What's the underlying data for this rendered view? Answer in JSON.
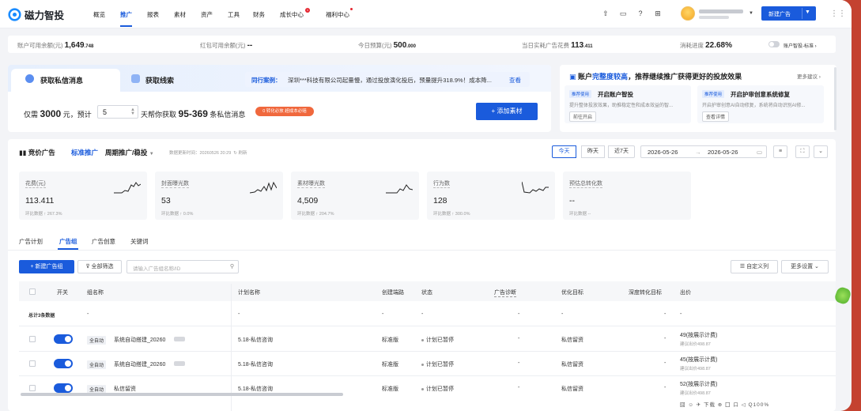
{
  "app": {
    "name": "磁力智投"
  },
  "nav": {
    "items": [
      "概览",
      "推广",
      "报表",
      "素材",
      "资产",
      "工具",
      "财务",
      "成长中心",
      "福利中心"
    ],
    "active": "推广",
    "growth_badge": "1",
    "new_ad_label": "新建广告"
  },
  "account": {
    "available_label": "账户可用余额(元)",
    "available_value": "1,649",
    "available_decimal": ".748",
    "redpacket_label": "红包可用余额(元)",
    "redpacket_value": "--",
    "budget_label": "今日预算(元)",
    "budget_value": "500",
    "budget_decimal": ".000",
    "spend_label": "当日实耗广告花费",
    "spend_value": "113",
    "spend_decimal": ".411",
    "progress_label": "消耗进度",
    "progress_value": "22.68%",
    "smart_label": "账户智投-标准"
  },
  "promo": {
    "tab1": "获取私信消息",
    "tab2": "获取线索",
    "case_tag": "同行案例：",
    "case_text": "深圳***科技有限公司起量慢，通过投放演化投后，预量提升318.9%！成本降...",
    "case_link": "查看",
    "budget_prefix": "仅需",
    "budget_amount": "3000",
    "budget_mid": "元，预计",
    "days": "5",
    "budget_get": "天帮你获取",
    "range": "95-369",
    "range_suffix": "条私信消息",
    "orange_badge": "0 转化必放 超成本必赔",
    "add_material": "+ 添加素材"
  },
  "health": {
    "title_prefix": "账户",
    "title_highlight": "完整度较高",
    "title_suffix": "，推荐继续推广获得更好的投放效果",
    "more": "更多建议 ›",
    "cards": [
      {
        "badge": "推荐使用",
        "title": "开启账户智投",
        "desc": "提升整体投放效果，助推稳定性和成本效益的智...",
        "button": "前往开启"
      },
      {
        "badge": "推荐使用",
        "title": "开启护审创意系统修复",
        "desc": "开启护审创意AI自动修复，系统将自动识别AI修...",
        "button": "查看详情"
      }
    ]
  },
  "campaign": {
    "section": "竞价广告",
    "standard": "标准推广",
    "periodic": "周期推广/稳投",
    "update_time": "数据更新时间：20260526 20:29",
    "refresh": "刷新",
    "date_buttons": [
      "今天",
      "昨天",
      "近7天"
    ],
    "start_date": "2026-05-26",
    "end_date": "2026-05-26"
  },
  "metrics": [
    {
      "label": "花费(元)",
      "value": "113.411",
      "change": "环比数据 ↑ 267.3%"
    },
    {
      "label": "封面曝光数",
      "value": "53",
      "change": "环比数据 ↑ 0.0%"
    },
    {
      "label": "素材曝光数",
      "value": "4,509",
      "change": "环比数据 ↑ 204.7%"
    },
    {
      "label": "行为数",
      "value": "128",
      "change": "环比数据 ↑ 300.0%"
    },
    {
      "label": "预估总转化数",
      "value": "--",
      "change": "环比数据 --"
    }
  ],
  "subtabs": [
    "广告计划",
    "广告组",
    "广告创意",
    "关键词"
  ],
  "toolbar": {
    "new_group": "+ 新建广告组",
    "filter": "全部筛选",
    "search_placeholder": "请输入广告组名称/ID",
    "custom_columns": "自定义列",
    "more_settings": "更多设置"
  },
  "table": {
    "headers": [
      "开关",
      "组名称",
      "计划名称",
      "创建端路",
      "状态",
      "广告诊断",
      "优化目标",
      "深度转化目标",
      "出价"
    ],
    "total_label": "总计3条数据",
    "total_dash": "-",
    "rows": [
      {
        "tag": "全自动",
        "name": "系统自动搭建_20260",
        "plan": "5.18-私信咨询",
        "channel": "标准版",
        "status": "计划已暂停",
        "diag": "-",
        "goal": "私信留资",
        "deep": "-",
        "bid": "49(按展示计费)",
        "bid_sub": "建议出价498.87"
      },
      {
        "tag": "全自动",
        "name": "系统自动搭建_20260",
        "plan": "5.18-私信咨询",
        "channel": "标准版",
        "status": "计划已暂停",
        "diag": "-",
        "goal": "私信留资",
        "deep": "-",
        "bid": "45(按展示计费)",
        "bid_sub": "建议出价498.87"
      },
      {
        "tag": "全自动",
        "name": "私信留资",
        "plan": "5.18-私信咨询",
        "channel": "标准版",
        "status": "计划已暂停",
        "diag": "-",
        "goal": "私信留资",
        "deep": "-",
        "bid": "52(按展示计费)",
        "bid_sub": "建议出价498.87"
      }
    ]
  },
  "statusbar": {
    "text": "囧 ☺ ✈ 下载 ⊕ 囗 口 ◁ Q100%"
  },
  "colors": {
    "primary": "#1a5bdc",
    "orange": "#f0683d",
    "bg": "#f3f4f7"
  }
}
